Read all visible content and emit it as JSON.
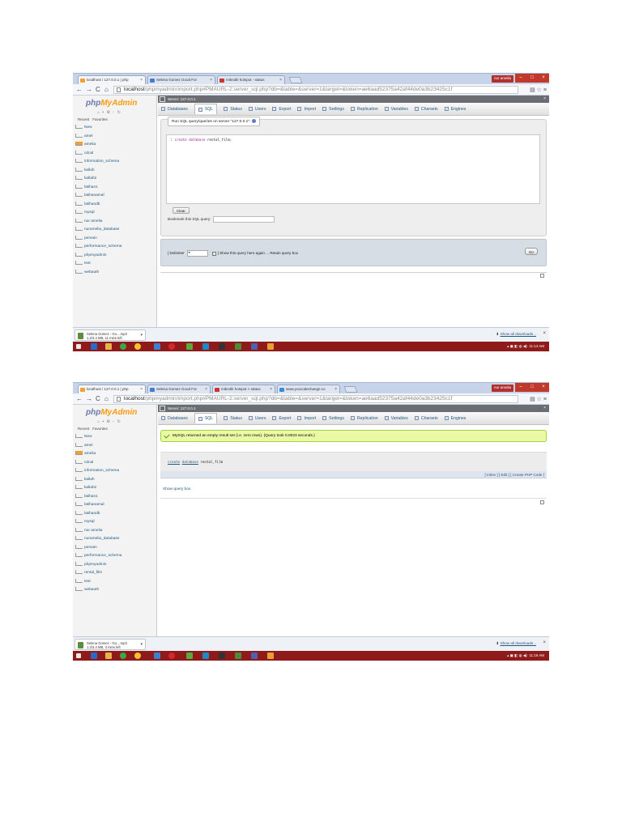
{
  "shot1": {
    "tabs": [
      {
        "label": "localhost / 127.0.0.1 | php"
      },
      {
        "label": "Selena Gomez Good For"
      },
      {
        "label": "mikrotik hotspot - status"
      }
    ],
    "user_badge": "nur amelia",
    "url_host": "localhost",
    "url_rest": "/phpmyadmin/import.php#PMAURL-2:server_sql.php?db=&table=&server=1&target=&token=ae6aad52375a42af44de0a3b23425c1f",
    "server_label": "Server: 127.0.0.1",
    "databases": [
      "New",
      "amel",
      "amelia",
      "cdcal",
      "information_schema",
      "kallah",
      "kallah2",
      "latihan1",
      "latihanamal",
      "latihandb",
      "mysql",
      "nur amelia",
      "nuramelia_database",
      "pemain",
      "performance_schema",
      "phpmyadmin",
      "test",
      "webauth"
    ],
    "sql_legend": "Run SQL query/queries on server \"127.0.0.1\":",
    "sql_line_no": "1",
    "sql_keyword1": "create",
    "sql_keyword2": "database",
    "sql_rest": "rental_film;",
    "clear_label": "Clear",
    "bookmark_label": "Bookmark this SQL query:",
    "delimiter_label": "[ Delimiter",
    "delimiter_value": ";",
    "show_again_label": "] Show this query here again",
    "retain_label": "Retain query box",
    "go_label": "Go",
    "download_name": "Selena Gomez - Go....mp3",
    "download_status": "1.2/3.4 MB, 11 mins left",
    "clock": "11:14 AM"
  },
  "shot2": {
    "tabs": [
      {
        "label": "localhost / 127.0.0.1 | php"
      },
      {
        "label": "Selena Gomez Good For"
      },
      {
        "label": "mikrotik hotspot > status"
      },
      {
        "label": "www.youcodechange.co"
      }
    ],
    "user_badge": "nur amelia",
    "url_host": "localhost",
    "url_rest": "/phpmyadmin/import.php#PMAURL-2:server_sql.php?db=&table=&server=1&target=&token=ae6aad52375a42af44de0a3b23425c1f",
    "server_label": "Server: 127.0.0.1",
    "databases": [
      "New",
      "amel",
      "amelia",
      "cdcal",
      "information_schema",
      "kallah",
      "kallah2",
      "latihan1",
      "latihanamal",
      "latihandb",
      "mysql",
      "nur amelia",
      "nuramelia_database",
      "pemain",
      "performance_schema",
      "phpmyadmin",
      "rental_film",
      "test",
      "webauth"
    ],
    "success_message": "MySQL returned an empty result set (i.e. zero rows). (Query took 0.0023 seconds.)",
    "result_kw1": "create",
    "result_kw2": "database",
    "result_rest": "rental_film",
    "result_links": "[ Inline ] [ Edit ] [ Create PHP Code ]",
    "show_query_box": "Show query box",
    "download_name": "Selena Gomez - Go....mp3",
    "download_status": "1.2/3.4 MB, 3 mins left",
    "clock": "11:15 AM"
  },
  "common": {
    "logo_php": "php",
    "logo_myadmin": "MyAdmin",
    "recent_label": "Recent",
    "favorites_label": "Favorites",
    "menu": [
      "Databases",
      "SQL",
      "Status",
      "Users",
      "Export",
      "Import",
      "Settings",
      "Replication",
      "Variables",
      "Charsets",
      "Engines"
    ],
    "show_all_downloads": "Show all downloads...",
    "colors": {
      "taskbar": "#8f1a1a",
      "success_bg": "#ebf8a4",
      "logo_blue": "#6c78af",
      "logo_orange": "#f89c0e",
      "link": "#235a81"
    },
    "icons": [
      "back-arrow-icon",
      "forward-arrow-icon",
      "reload-icon",
      "home-icon",
      "bookmark-star-icon",
      "menu-icon",
      "help-icon",
      "check-icon",
      "close-icon"
    ]
  }
}
